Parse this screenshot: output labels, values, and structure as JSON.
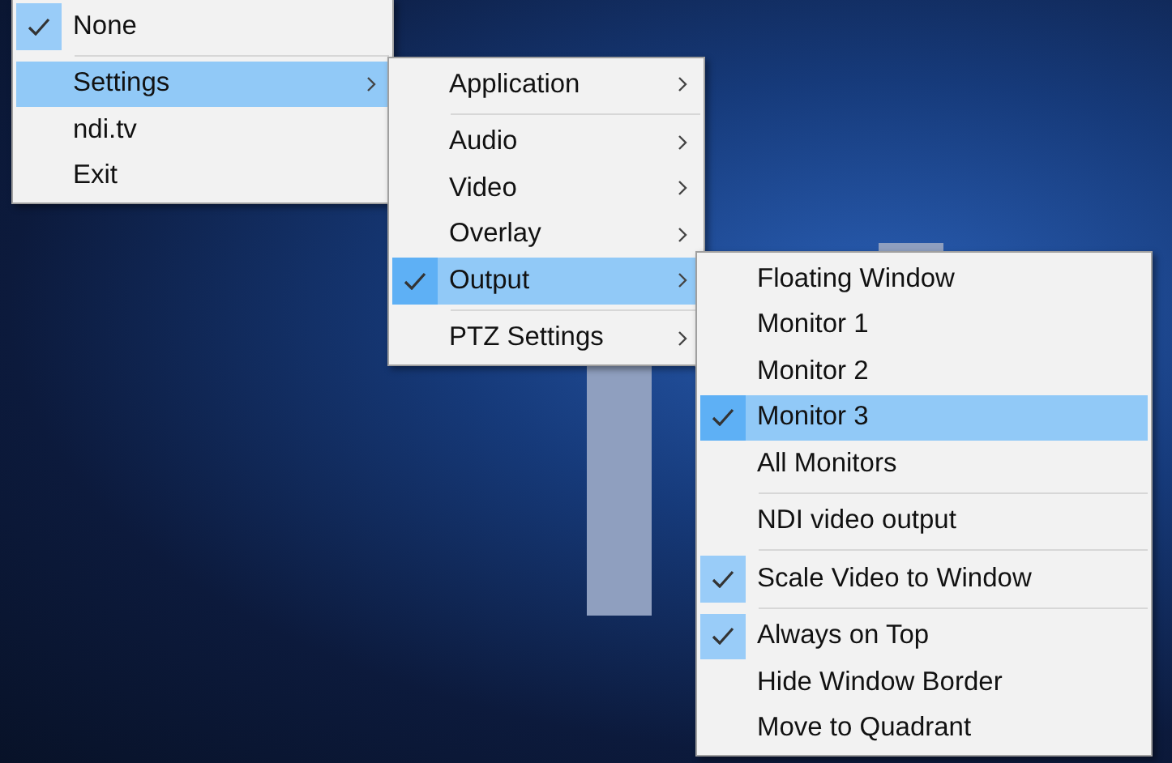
{
  "menus": [
    {
      "items": [
        {
          "kind": "item",
          "label": "None",
          "checked": true,
          "selected": false,
          "submenu": false
        },
        {
          "kind": "separator"
        },
        {
          "kind": "item",
          "label": "Settings",
          "checked": false,
          "selected": true,
          "submenu": true
        },
        {
          "kind": "item",
          "label": "ndi.tv",
          "checked": false,
          "selected": false,
          "submenu": false
        },
        {
          "kind": "item",
          "label": "Exit",
          "checked": false,
          "selected": false,
          "submenu": false
        }
      ]
    },
    {
      "items": [
        {
          "kind": "item",
          "label": "Application",
          "checked": false,
          "selected": false,
          "submenu": true
        },
        {
          "kind": "separator"
        },
        {
          "kind": "item",
          "label": "Audio",
          "checked": false,
          "selected": false,
          "submenu": true
        },
        {
          "kind": "item",
          "label": "Video",
          "checked": false,
          "selected": false,
          "submenu": true
        },
        {
          "kind": "item",
          "label": "Overlay",
          "checked": false,
          "selected": false,
          "submenu": true
        },
        {
          "kind": "item",
          "label": "Output",
          "checked": true,
          "selected": true,
          "submenu": true
        },
        {
          "kind": "separator"
        },
        {
          "kind": "item",
          "label": "PTZ Settings",
          "checked": false,
          "selected": false,
          "submenu": true
        }
      ]
    },
    {
      "items": [
        {
          "kind": "item",
          "label": "Floating Window",
          "checked": false,
          "selected": false,
          "submenu": false
        },
        {
          "kind": "item",
          "label": "Monitor 1",
          "checked": false,
          "selected": false,
          "submenu": false
        },
        {
          "kind": "item",
          "label": "Monitor 2",
          "checked": false,
          "selected": false,
          "submenu": false
        },
        {
          "kind": "item",
          "label": "Monitor 3",
          "checked": true,
          "selected": true,
          "submenu": false
        },
        {
          "kind": "item",
          "label": "All Monitors",
          "checked": false,
          "selected": false,
          "submenu": false
        },
        {
          "kind": "separator"
        },
        {
          "kind": "item",
          "label": "NDI video output",
          "checked": false,
          "selected": false,
          "submenu": false
        },
        {
          "kind": "separator"
        },
        {
          "kind": "item",
          "label": "Scale Video to Window",
          "checked": true,
          "selected": false,
          "submenu": false
        },
        {
          "kind": "separator"
        },
        {
          "kind": "item",
          "label": "Always on Top",
          "checked": true,
          "selected": false,
          "submenu": false
        },
        {
          "kind": "item",
          "label": "Hide Window Border",
          "checked": false,
          "selected": false,
          "submenu": false
        },
        {
          "kind": "item",
          "label": "Move to Quadrant",
          "checked": false,
          "selected": false,
          "submenu": false
        }
      ]
    }
  ]
}
